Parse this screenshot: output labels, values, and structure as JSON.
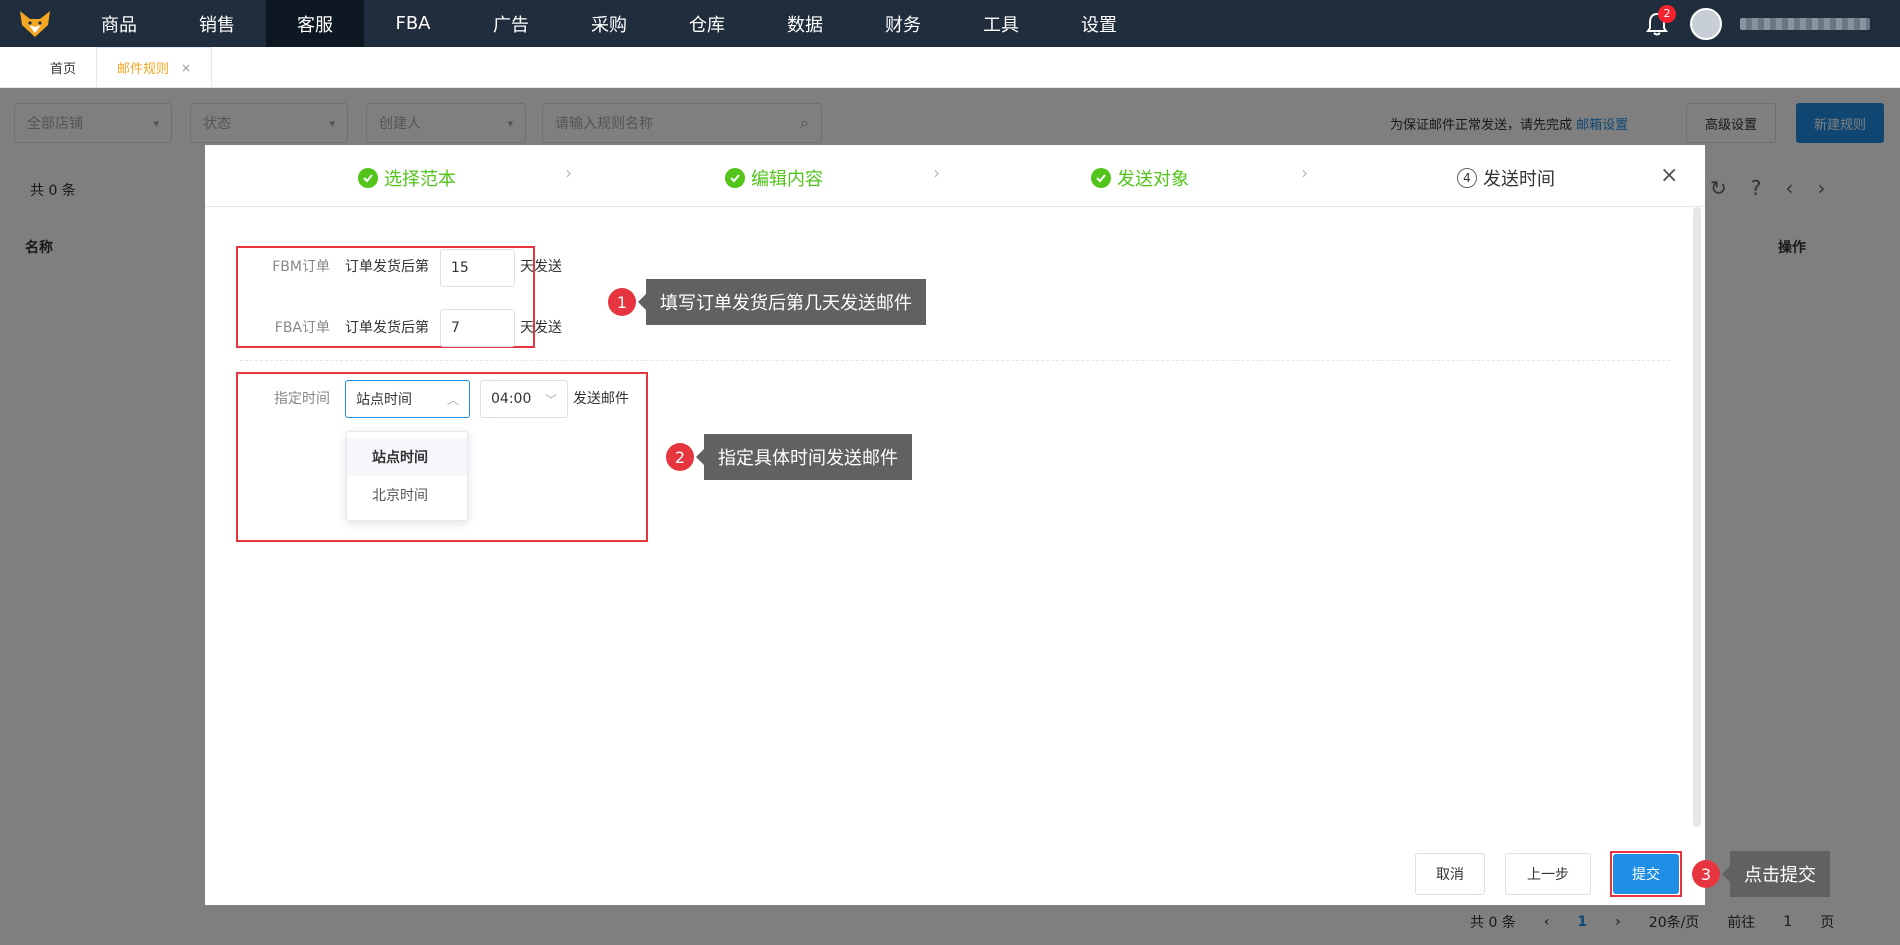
{
  "topnav": {
    "items": [
      "商品",
      "销售",
      "客服",
      "FBA",
      "广告",
      "采购",
      "仓库",
      "数据",
      "财务",
      "工具",
      "设置"
    ],
    "active": "客服",
    "notification_count": "2"
  },
  "tabs": {
    "home": "首页",
    "current": "邮件规则",
    "close": "×"
  },
  "filters": {
    "shop_placeholder": "全部店铺",
    "status_placeholder": "状态",
    "creator_placeholder": "创建人",
    "search_placeholder": "请输入规则名称",
    "notice": "为保证邮件正常发送，请先完成",
    "notice_link": "邮箱设置",
    "advanced_label": "高级设置",
    "new_rule_label": "新建规则"
  },
  "list": {
    "count": "共 0 条",
    "col_name": "名称",
    "col_op": "操作"
  },
  "pager": {
    "total": "共 0 条",
    "current_page": "1",
    "page_size": "20条/页",
    "goto": "前往",
    "goto_value": "1",
    "page_unit": "页"
  },
  "modal": {
    "steps": [
      {
        "label": "选择范本",
        "state": "done"
      },
      {
        "label": "编辑内容",
        "state": "done"
      },
      {
        "label": "发送对象",
        "state": "done"
      },
      {
        "label": "发送时间",
        "state": "current",
        "num": "4"
      }
    ],
    "fbm": {
      "label": "FBM订单",
      "prefix": "订单发货后第",
      "value": "15",
      "suffix": "天发送"
    },
    "fba": {
      "label": "FBA订单",
      "prefix": "订单发货后第",
      "value": "7",
      "suffix": "天发送"
    },
    "specify": {
      "label": "指定时间",
      "zone_value": "站点时间",
      "time_value": "04:00",
      "suffix": "发送邮件",
      "options": [
        "站点时间",
        "北京时间"
      ]
    },
    "buttons": {
      "cancel": "取消",
      "prev": "上一步",
      "submit": "提交"
    }
  },
  "callouts": [
    {
      "num": "1",
      "text": "填写订单发货后第几天发送邮件"
    },
    {
      "num": "2",
      "text": "指定具体时间发送邮件"
    },
    {
      "num": "3",
      "text": "点击提交"
    }
  ],
  "colors": {
    "topbar": "#1f2d3d",
    "primary": "#1f8ee5",
    "success": "#52c41a",
    "annotation_red": "#e6353e",
    "tab_active": "#f5a623"
  }
}
